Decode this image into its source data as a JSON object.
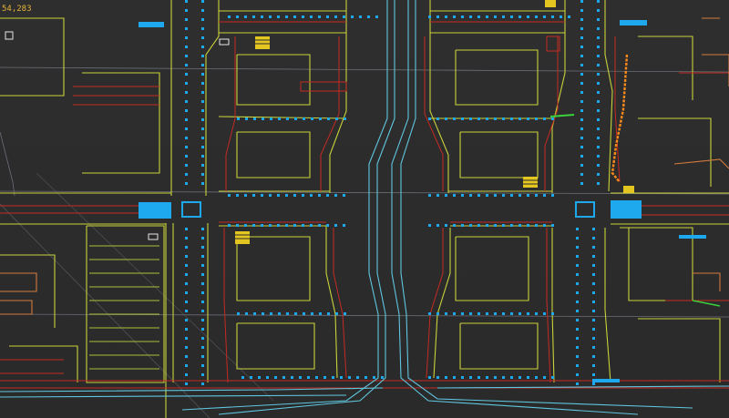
{
  "viewport": {
    "coordinate_readout": "54,283"
  },
  "colors": {
    "background": "#2c2c2c",
    "boundary_yellow": "#c8d23a",
    "lane_red": "#c42a22",
    "lane_cyan": "#5fc6df",
    "crosswalk_blue": "#1ea8ee",
    "stop_line_yellow": "#e3c61f",
    "grid_gray": "#7a7f8a",
    "curb_orange": "#d27a3c",
    "highlight_orange": "#ff8c1a"
  },
  "layers": [
    {
      "name": "road-boundaries",
      "color": "boundary_yellow"
    },
    {
      "name": "lane-lines",
      "color": "lane_red"
    },
    {
      "name": "center-lanes",
      "color": "lane_cyan"
    },
    {
      "name": "crosswalks",
      "color": "crosswalk_blue"
    },
    {
      "name": "stop-lines",
      "color": "stop_line_yellow"
    },
    {
      "name": "curbs",
      "color": "curb_orange"
    },
    {
      "name": "grid",
      "color": "grid_gray"
    }
  ]
}
